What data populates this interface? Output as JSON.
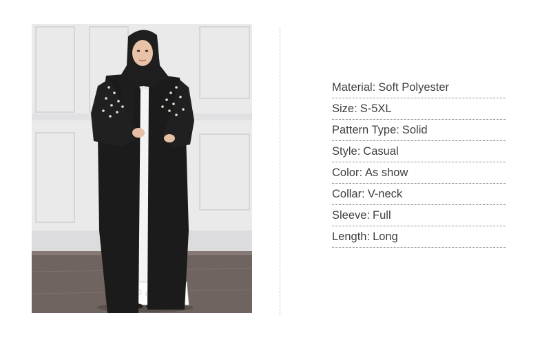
{
  "product_photo": {
    "alt": "Model wearing black open abaya cardigan with pearl beading over white lace dress and black hijab"
  },
  "specs": [
    {
      "key": "Material",
      "value": "Soft Polyester"
    },
    {
      "key": "Size",
      "value": "S-5XL"
    },
    {
      "key": "Pattern Type",
      "value": "Solid"
    },
    {
      "key": "Style",
      "value": "Casual"
    },
    {
      "key": "Color",
      "value": "As show"
    },
    {
      "key": "Collar",
      "value": "V-neck"
    },
    {
      "key": "Sleeve",
      "value": "Full"
    },
    {
      "key": "Length",
      "value": "Long"
    }
  ],
  "colors": {
    "text": "#3f3f3f",
    "garment": "#1b1b1b",
    "dress": "#f4f4f4",
    "wall": "#e9e9ea",
    "floor": "#6f6460"
  }
}
